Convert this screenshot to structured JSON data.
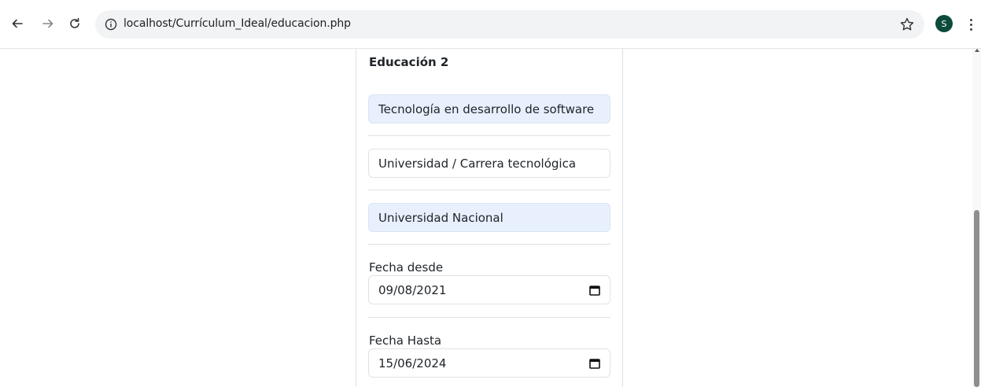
{
  "browser": {
    "url": "localhost/Currículum_Ideal/educacion.php",
    "profile_initial": "S",
    "icons": [
      "back-arrow-icon",
      "forward-arrow-icon",
      "reload-icon",
      "info-icon",
      "star-icon",
      "menu-dots-icon"
    ]
  },
  "form": {
    "section_title": "Educación 2",
    "title_value": "Tecnología en desarrollo de software",
    "level_value": "Universidad / Carrera tecnológica",
    "institution_value": "Universidad Nacional",
    "date_from_label": "Fecha desde",
    "date_from_value": "09/08/2021",
    "date_to_label": "Fecha Hasta",
    "date_to_value": "15/06/2024"
  },
  "colors": {
    "autofill_bg": "#e8f0fe",
    "avatar_bg": "#0d4a3c",
    "border": "#dee2e6"
  }
}
